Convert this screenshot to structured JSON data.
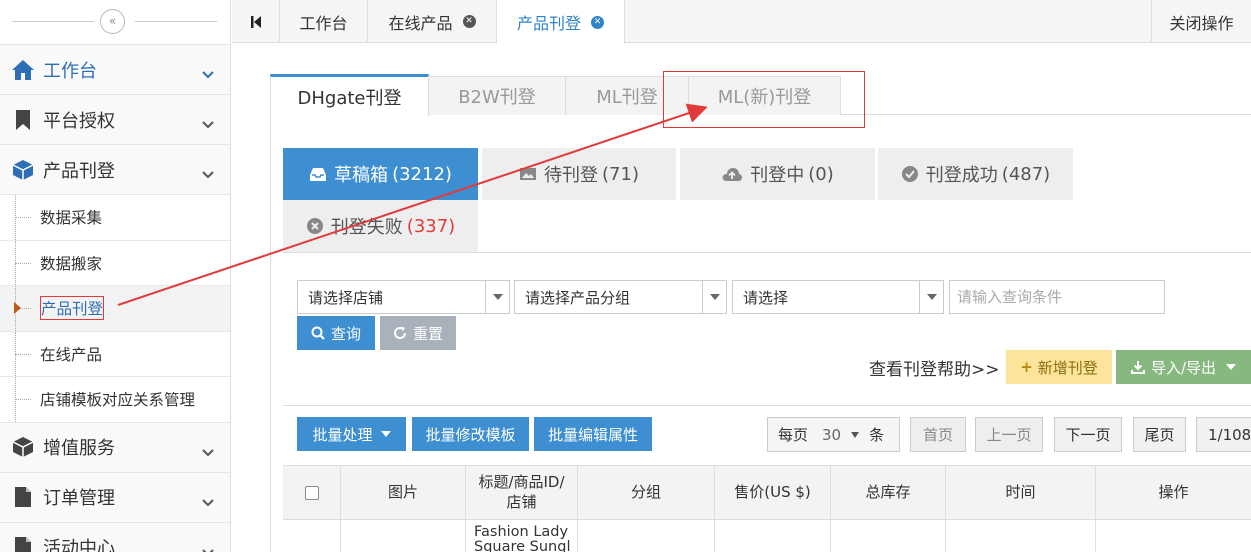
{
  "colors": {
    "accent": "#3d8fd1",
    "annotation": "#e23a3a",
    "sidebar_bg": "#f9f9f9"
  },
  "sidebar": {
    "collapse_glyph": "«",
    "menu": [
      {
        "label": "工作台",
        "icon": "home-icon"
      },
      {
        "label": "平台授权",
        "icon": "bookmark-icon"
      },
      {
        "label": "产品刊登",
        "icon": "cube-icon"
      }
    ],
    "sub_items": [
      {
        "label": "数据采集"
      },
      {
        "label": "数据搬家"
      },
      {
        "label": "产品刊登"
      },
      {
        "label": "在线产品"
      },
      {
        "label": "店铺模板对应关系管理"
      }
    ],
    "menu_bottom": [
      {
        "label": "增值服务",
        "icon": "cube-icon"
      },
      {
        "label": "订单管理",
        "icon": "document-icon"
      },
      {
        "label": "活动中心",
        "icon": "document-icon"
      }
    ]
  },
  "topbar": {
    "tabs": [
      {
        "label": "工作台"
      },
      {
        "label": "在线产品"
      },
      {
        "label": "产品刊登"
      }
    ],
    "close_glyph": "✕",
    "close_ops": "关闭操作"
  },
  "platform_tabs": [
    "DHgate刊登",
    "B2W刊登",
    "ML刊登",
    "ML(新)刊登"
  ],
  "status_tabs": [
    {
      "label": "草稿箱",
      "count": "(3212)"
    },
    {
      "label": "待刊登",
      "count": "(71)"
    },
    {
      "label": "刊登中",
      "count": "(0)"
    },
    {
      "label": "刊登成功",
      "count": "(487)"
    },
    {
      "label": "刊登失败",
      "count": "(337)"
    }
  ],
  "filters": {
    "shop": "请选择店铺",
    "group": "请选择产品分组",
    "other": "请选择",
    "query_placeholder": "请输入查询条件"
  },
  "buttons": {
    "search": "查询",
    "reset": "重置",
    "help": "查看刊登帮助>>",
    "add": "新增刊登",
    "import_export": "导入/导出",
    "batch": "批量处理",
    "batch_template": "批量修改模板",
    "batch_attr": "批量编辑属性"
  },
  "pagination": {
    "per_page_label": "每页",
    "per_page_value": "30",
    "per_page_unit": "条",
    "first": "首页",
    "prev": "上一页",
    "next": "下一页",
    "last": "尾页",
    "page": "1/108"
  },
  "table": {
    "headers": [
      "图片",
      "标题/商品ID/店铺",
      "分组",
      "售价(US $)",
      "总库存",
      "时间",
      "操作"
    ],
    "rows": [
      {
        "title_line1": "Fashion Lady",
        "title_line2": "Square Sungl"
      }
    ]
  }
}
